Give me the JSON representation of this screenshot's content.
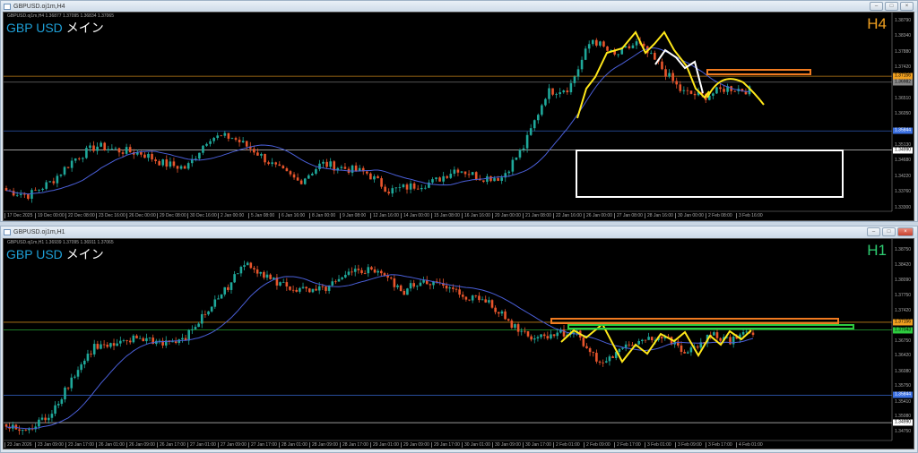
{
  "windows": [
    {
      "title": "GBPUSD.oj1m,H4",
      "ohlc": "GBPUSD.oj1m,H4  1.36877 1.37095 1.36834 1.37065",
      "symbol": "GBP USD",
      "label": "メイン",
      "timeframe": "H4",
      "timeframe_color": "#f0a020",
      "price_labels": [
        "1.38790",
        "1.38340",
        "1.37880",
        "1.37420",
        "1.36510",
        "1.36050",
        "1.35130",
        "1.34680",
        "1.34220",
        "1.33760",
        "1.33300"
      ],
      "price_values": [
        1.3879,
        1.3834,
        1.3788,
        1.3742,
        1.3651,
        1.3605,
        1.3513,
        1.3468,
        1.3422,
        1.3376,
        1.333
      ],
      "price_boxes": [
        {
          "text": "1.37156",
          "price": 1.37156,
          "color": "#f0a020"
        },
        {
          "text": "1.36982",
          "price": 1.36982,
          "color": "#888888"
        },
        {
          "text": "1.35844",
          "price": 1.3555,
          "color": "#3a6fe0"
        },
        {
          "text": "1.34990",
          "price": 1.3499,
          "color": "#ffffff"
        }
      ],
      "time_labels": [
        "17 Dec 2025",
        "19 Dec 00:00",
        "22 Dec 08:00",
        "23 Dec 16:00",
        "26 Dec 00:00",
        "29 Dec 08:00",
        "30 Dec 16:00",
        "2 Jan 00:00",
        "5 Jan 08:00",
        "6 Jan 16:00",
        "8 Jan 00:00",
        "9 Jan 08:00",
        "12 Jan 16:00",
        "14 Jan 00:00",
        "15 Jan 08:00",
        "16 Jan 16:00",
        "20 Jan 00:00",
        "21 Jan 08:00",
        "22 Jan 16:00",
        "26 Jan 00:00",
        "27 Jan 08:00",
        "28 Jan 16:00",
        "30 Jan 00:00",
        "2 Feb 08:00",
        "3 Feb 16:00"
      ],
      "closes_keypoints": [
        1.338,
        1.3367,
        1.3406,
        1.3472,
        1.3511,
        1.3498,
        1.349,
        1.3459,
        1.3446,
        1.3537,
        1.3537,
        1.3498,
        1.3446,
        1.3406,
        1.3459,
        1.3446,
        1.3432,
        1.338,
        1.3393,
        1.3406,
        1.3446,
        1.3419,
        1.3419,
        1.3511,
        1.3669,
        1.3682,
        1.3826,
        1.3774,
        1.3813,
        1.3747,
        1.3669,
        1.3656,
        1.3682,
        1.3674
      ]
    },
    {
      "title": "GBPUSD.oj1m,H1",
      "ohlc": "GBPUSD.oj1m,H1  1.36939 1.37095 1.36911 1.37065",
      "symbol": "GBP USD",
      "label": "メイン",
      "timeframe": "H1",
      "timeframe_color": "#2ecc71",
      "price_labels": [
        "1.38750",
        "1.38420",
        "1.38090",
        "1.37750",
        "1.37420",
        "1.36750",
        "1.36420",
        "1.36080",
        "1.35750",
        "1.35410",
        "1.35080",
        "1.34750"
      ],
      "price_values": [
        1.3875,
        1.3842,
        1.3809,
        1.3775,
        1.3742,
        1.3675,
        1.3642,
        1.3608,
        1.3575,
        1.3541,
        1.3508,
        1.3475
      ],
      "price_boxes": [
        {
          "text": "1.37156",
          "price": 1.37156,
          "color": "#f0a020"
        },
        {
          "text": "1.37043",
          "price": 1.36985,
          "color": "#2ecc40"
        },
        {
          "text": "1.35844",
          "price": 1.3555,
          "color": "#3a6fe0"
        },
        {
          "text": "1.34990",
          "price": 1.34945,
          "color": "#ffffff"
        }
      ],
      "time_labels": [
        "23 Jan 2026",
        "23 Jan 09:00",
        "23 Jan 17:00",
        "26 Jan 01:00",
        "26 Jan 09:00",
        "26 Jan 17:00",
        "27 Jan 01:00",
        "27 Jan 09:00",
        "27 Jan 17:00",
        "28 Jan 01:00",
        "28 Jan 09:00",
        "28 Jan 17:00",
        "29 Jan 01:00",
        "29 Jan 09:00",
        "29 Jan 17:00",
        "30 Jan 01:00",
        "30 Jan 09:00",
        "30 Jan 17:00",
        "2 Feb 01:00",
        "2 Feb 09:00",
        "2 Feb 17:00",
        "3 Feb 01:00",
        "3 Feb 09:00",
        "3 Feb 17:00",
        "4 Feb 01:00"
      ],
      "closes_keypoints": [
        1.3485,
        1.3475,
        1.3514,
        1.3593,
        1.3662,
        1.3662,
        1.3682,
        1.3672,
        1.3672,
        1.3731,
        1.379,
        1.3849,
        1.381,
        1.379,
        1.378,
        1.38,
        1.383,
        1.383,
        1.378,
        1.381,
        1.379,
        1.3771,
        1.3761,
        1.3711,
        1.3682,
        1.3692,
        1.3692,
        1.3623,
        1.3652,
        1.3682,
        1.3682,
        1.3643,
        1.3688,
        1.3672,
        1.3696
      ]
    }
  ],
  "colors": {
    "bull": "#1fa89a",
    "bear": "#e8552c",
    "ma": "#4a5fd8"
  }
}
